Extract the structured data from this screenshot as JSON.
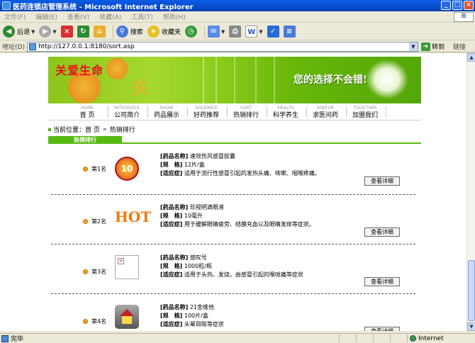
{
  "window": {
    "title": "医药连锁店管理系统 - Microsoft Internet Explorer"
  },
  "menu": [
    "文件(F)",
    "编辑(E)",
    "查看(V)",
    "收藏(A)",
    "工具(T)",
    "帮助(H)"
  ],
  "toolbar": {
    "back": "后退",
    "search": "搜索",
    "favorites": "收藏夹"
  },
  "address": {
    "label": "地址(D)",
    "url": "http://127.0.0.1:8180/sort.asp",
    "go": "转到",
    "links": "链接"
  },
  "banner": {
    "brand": "关爱生命",
    "brand_mark": "关",
    "slogan": "您的选择不会错!"
  },
  "nav": [
    {
      "en": "HOME",
      "cn": "首 页"
    },
    {
      "en": "INTRODUCE",
      "cn": "公司简介"
    },
    {
      "en": "SHOW",
      "cn": "药品展示"
    },
    {
      "en": "GOODMED",
      "cn": "好药推荐"
    },
    {
      "en": "SORT",
      "cn": "热销排行"
    },
    {
      "en": "HEALTH",
      "cn": "科学养生"
    },
    {
      "en": "ASKFOR",
      "cn": "求医问药"
    },
    {
      "en": "TOGETHER",
      "cn": "加盟我们"
    }
  ],
  "breadcrumb": {
    "prefix": "当前位置：首 页",
    "arrows": "»",
    "current": "热销排行"
  },
  "section": {
    "tab": "热销排行"
  },
  "labels": {
    "name": "[药品名称]",
    "spec": "[规　格]",
    "indication": "[适应症]",
    "detail": "查看详细"
  },
  "products": [
    {
      "rank": "第1名",
      "thumb": "10",
      "name": "速效伤风感冒胶囊",
      "spec": "12片/盒",
      "indication": "适用于流行性感冒引起的发热头痛、咳嗽、咽喉疼痛。"
    },
    {
      "rank": "第2名",
      "thumb": "HOT",
      "name": "珍视明滴眼液",
      "spec": "10毫升",
      "indication": "用于缓解眼睛疲劳、结膜充血以及眼睛发痒等症状。"
    },
    {
      "rank": "第3名",
      "thumb": "",
      "name": "感叹号",
      "spec": "1000粒/瓶",
      "indication": "适用于头热、发烧，由感冒引起的喉咙痛等症状"
    },
    {
      "rank": "第4名",
      "thumb": "",
      "name": "21金维他",
      "spec": "100片/盒",
      "indication": "头晕目眩等症状"
    }
  ],
  "status": {
    "text": "完毕",
    "zone": "Internet"
  }
}
